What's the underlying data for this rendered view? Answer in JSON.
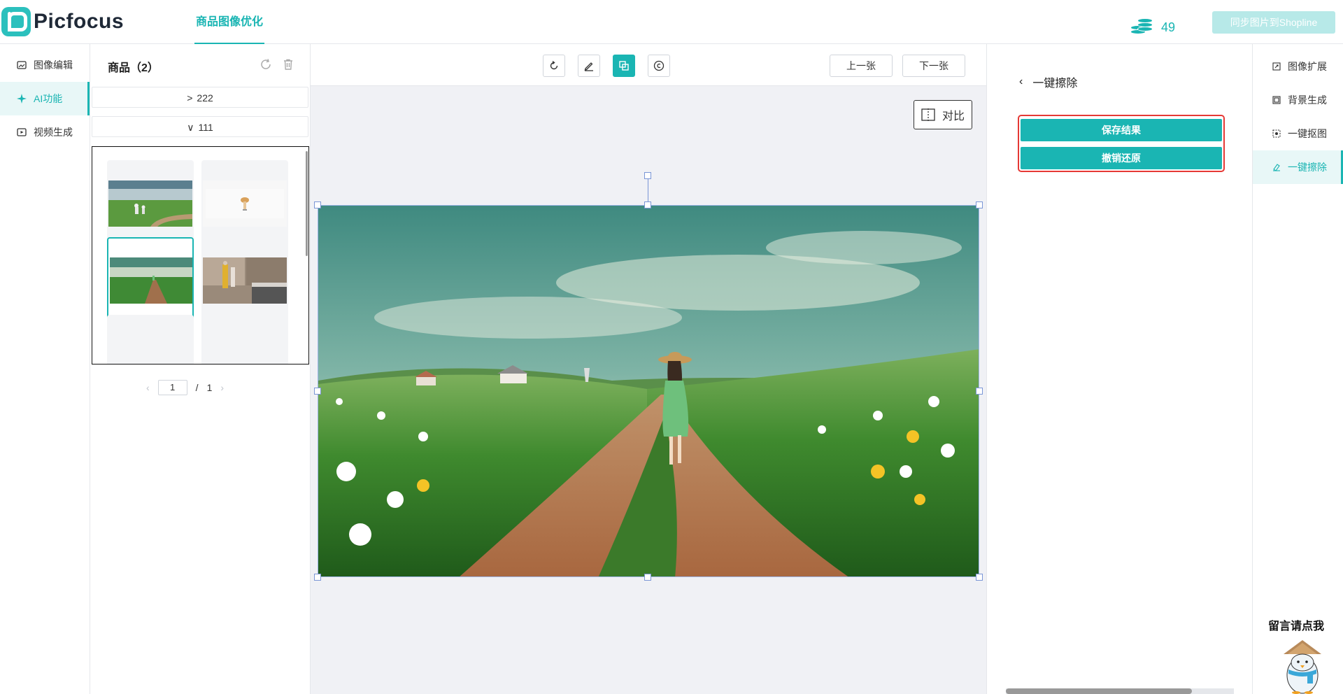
{
  "header": {
    "logo_text": "Picfocus",
    "active_tab": "商品图像优化",
    "coin_count": "49",
    "sync_button": "同步图片到Shopline"
  },
  "leftnav": {
    "items": [
      {
        "label": "图像编辑",
        "icon": "image-edit-icon",
        "active": false
      },
      {
        "label": "AI功能",
        "icon": "ai-sparkle-icon",
        "active": true
      },
      {
        "label": "视频生成",
        "icon": "video-icon",
        "active": false
      }
    ]
  },
  "products": {
    "title": "商品（2）",
    "folders": [
      {
        "name": "222",
        "expanded": false
      },
      {
        "name": "111",
        "expanded": true
      }
    ],
    "thumbnails": [
      {
        "subject": "girls-running-in-meadow",
        "selected": false
      },
      {
        "subject": "small-figure-on-white",
        "selected": false
      },
      {
        "subject": "girl-on-dirt-road-meadow",
        "selected": true
      },
      {
        "subject": "bedroom-with-mannequin",
        "selected": false
      }
    ],
    "pager": {
      "current": "1",
      "separator": "/",
      "total": "1"
    }
  },
  "canvas": {
    "tools": [
      {
        "icon": "undo-rotate-icon",
        "active": false
      },
      {
        "icon": "brush-icon",
        "active": false
      },
      {
        "icon": "select-copy-icon",
        "active": true
      },
      {
        "icon": "copyright-icon",
        "active": false
      }
    ],
    "prev_button": "上一张",
    "next_button": "下一张",
    "compare_button": "对比",
    "image_subject": "girl-walking-on-dirt-road-through-meadow"
  },
  "rpanel": {
    "back_title": "一键擦除",
    "save_button": "保存结果",
    "undo_button": "撤销还原",
    "scroll_position": 0.82
  },
  "rnav": {
    "items": [
      {
        "label": "图像扩展",
        "icon": "expand-icon",
        "active": false
      },
      {
        "label": "背景生成",
        "icon": "background-icon",
        "active": false
      },
      {
        "label": "一键抠图",
        "icon": "cutout-icon",
        "active": false
      },
      {
        "label": "一键擦除",
        "icon": "eraser-icon",
        "active": true
      }
    ],
    "message": "留言请点我"
  },
  "colors": {
    "accent": "#1ab5b3",
    "accent_light": "#e8f7f7",
    "highlight_red": "#e53935",
    "sync_disabled": "#b7e9e8"
  }
}
